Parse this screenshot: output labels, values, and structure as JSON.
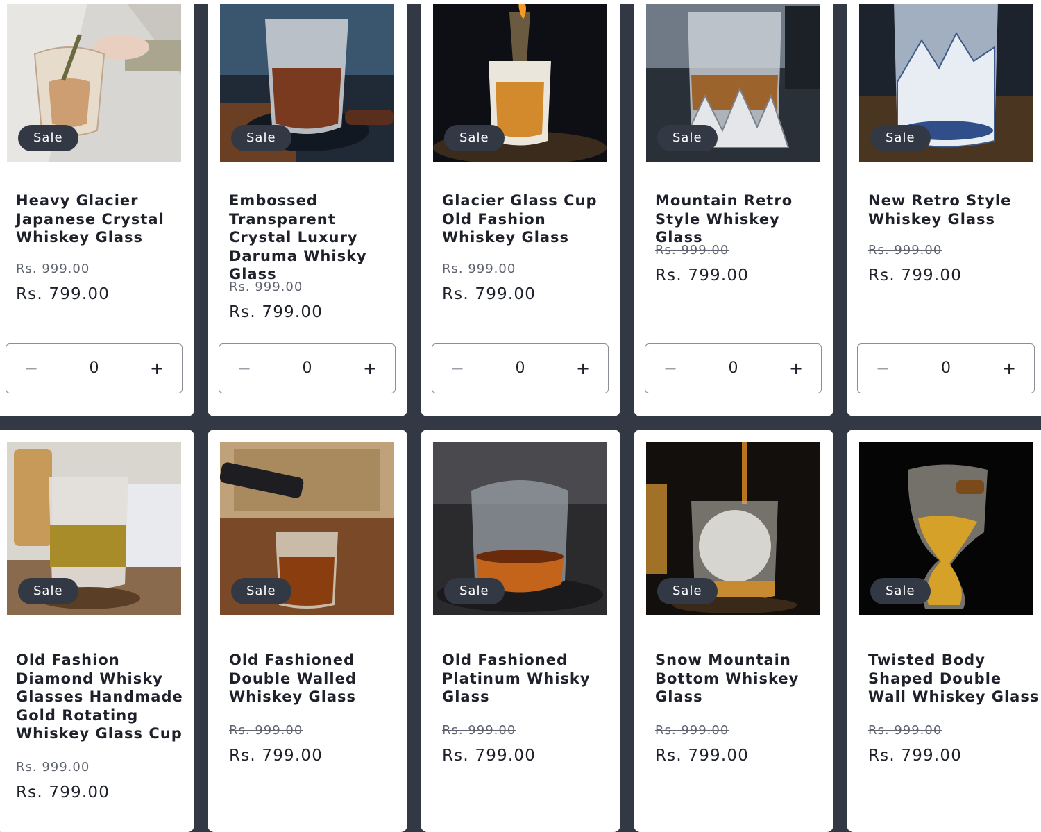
{
  "badge_label": "Sale",
  "currency_prefix": "Rs.",
  "products": [
    {
      "title": "Heavy Glacier Japanese Crystal Whiskey Glass",
      "was": "Rs. 999.00",
      "now": "Rs. 799.00",
      "qty": "0"
    },
    {
      "title": "Embossed Transparent Crystal Luxury Daruma Whisky Glass",
      "was": "Rs. 999.00",
      "now": "Rs. 799.00",
      "qty": "0"
    },
    {
      "title": "Glacier Glass Cup Old Fashion Whiskey Glass",
      "was": "Rs. 999.00",
      "now": "Rs. 799.00",
      "qty": "0"
    },
    {
      "title": "Mountain Retro Style Whiskey Glass",
      "was": "Rs. 999.00",
      "now": "Rs. 799.00",
      "qty": "0"
    },
    {
      "title": "New Retro Style Whiskey Glass",
      "was": "Rs. 999.00",
      "now": "Rs. 799.00",
      "qty": "0"
    },
    {
      "title": "Old Fashion Diamond Whisky Glasses Handmade Gold Rotating Whiskey Glass Cup",
      "was": "Rs. 999.00",
      "now": "Rs. 799.00"
    },
    {
      "title": "Old Fashioned Double Walled Whiskey Glass",
      "was": "Rs. 999.00",
      "now": "Rs. 799.00"
    },
    {
      "title": "Old Fashioned Platinum Whisky Glass",
      "was": "Rs. 999.00",
      "now": "Rs. 799.00"
    },
    {
      "title": "Snow Mountain Bottom Whiskey Glass",
      "was": "Rs. 999.00",
      "now": "Rs. 799.00"
    },
    {
      "title": "Twisted Body Shaped Double Wall Whiskey Glass",
      "was": "Rs. 999.00",
      "now": "Rs. 799.00"
    }
  ],
  "quantity": {
    "minus_icon": "minus-icon",
    "plus_icon": "plus-icon"
  },
  "colors": {
    "page_bg": "#323844",
    "card_bg": "#ffffff",
    "badge_bg": "#323844",
    "text": "#1e2129"
  }
}
